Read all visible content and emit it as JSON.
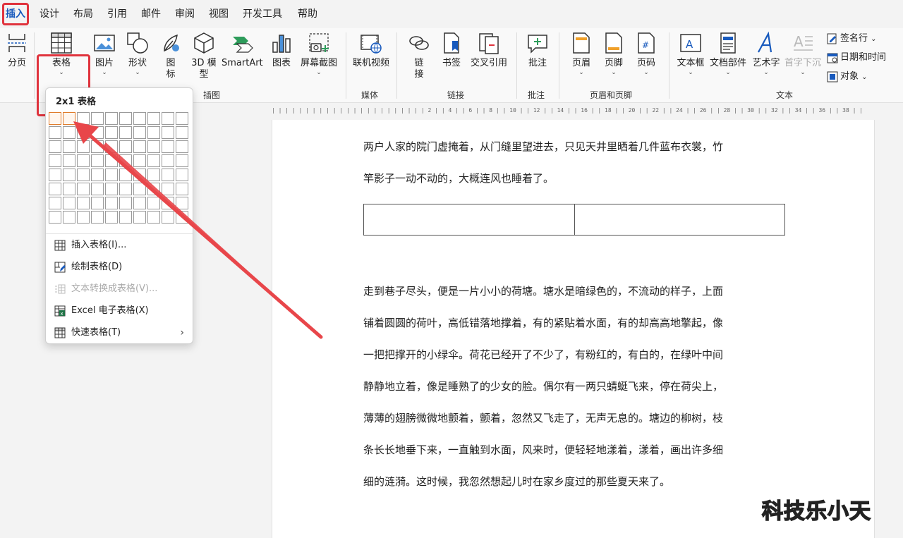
{
  "tabs": [
    "插入",
    "设计",
    "布局",
    "引用",
    "邮件",
    "审阅",
    "视图",
    "开发工具",
    "帮助"
  ],
  "ribbon": {
    "page_break": "分页",
    "table": "表格",
    "picture": "图片",
    "shapes": "形状",
    "icons": "图\n标",
    "model3d": "3D 模\n型",
    "smartart": "SmartArt",
    "chart": "图表",
    "screenshot": "屏幕截图",
    "online_video": "联机视频",
    "link": "链\n接",
    "bookmark": "书签",
    "cross_ref": "交叉引用",
    "comment": "批注",
    "header": "页眉",
    "footer": "页脚",
    "page_number": "页码",
    "textbox": "文本框",
    "doc_parts": "文档部件",
    "wordart": "艺术字",
    "dropcap": "首字下沉",
    "signature": "签名行",
    "datetime": "日期和时间",
    "object": "对象",
    "groups": {
      "illustrations": "插图",
      "media": "媒体",
      "links": "链接",
      "comments": "批注",
      "header_footer": "页眉和页脚",
      "text": "文本"
    }
  },
  "dropdown": {
    "title": "2x1 表格",
    "grid_cols": 10,
    "grid_rows": 8,
    "selected_cols": 2,
    "selected_rows": 1,
    "items": [
      {
        "label": "插入表格(I)...",
        "icon": "table-icon",
        "enabled": true
      },
      {
        "label": "绘制表格(D)",
        "icon": "draw-table-icon",
        "enabled": true
      },
      {
        "label": "文本转换成表格(V)...",
        "icon": "convert-icon",
        "enabled": false
      },
      {
        "label": "Excel 电子表格(X)",
        "icon": "excel-icon",
        "enabled": true
      },
      {
        "label": "快速表格(T)",
        "icon": "quick-table-icon",
        "enabled": true,
        "submenu": true
      }
    ]
  },
  "document": {
    "para1": [
      "两户人家的院门虚掩着，从门缝里望进去，只见天井里晒着几件蓝布衣裳，竹",
      "竿影子一动不动的，大概连风也睡着了。"
    ],
    "para2": [
      "走到巷子尽头，便是一片小小的荷塘。塘水是暗绿色的，不流动的样子，上面",
      "铺着圆圆的荷叶，高低错落地撑着，有的紧贴着水面，有的却高高地擎起，像",
      "一把把撑开的小绿伞。荷花已经开了不少了，有粉红的，有白的，在绿叶中间",
      "静静地立着，像是睡熟了的少女的脸。偶尔有一两只蜻蜓飞来，停在荷尖上，",
      "薄薄的翅膀微微地颤着，颤着，忽然又飞走了，无声无息的。塘边的柳树，枝",
      "条长长地垂下来，一直触到水面，风来时，便轻轻地漾着，漾着，画出许多细",
      "细的涟漪。这时候，我忽然想起儿时在家乡度过的那些夏天来了。"
    ]
  },
  "ruler_text": "| | | | | | | | | | | | | | | | | | | | | |  | 2 | | 4 | | 6 | | 8 | | 10 | | 12 | | 14 | | 16 | | 18 | | 20 | | 22 | | 24 | | 26 | | 28 | | 30 | | 32 | | 34 | | 36 | | 38 | |",
  "watermark": "科技乐小天",
  "colors": {
    "accent": "#185abd",
    "highlight": "#e0333d",
    "arrow": "#e8464a",
    "selected_cell": "#e07b2a"
  }
}
